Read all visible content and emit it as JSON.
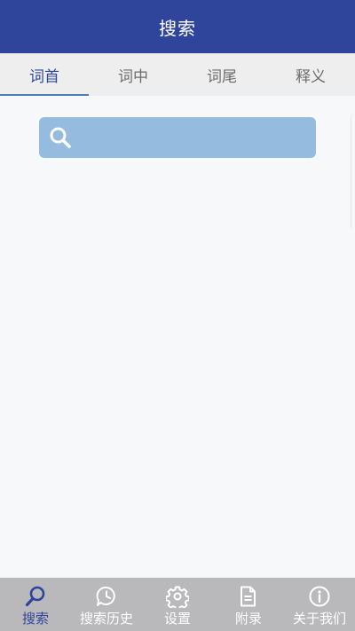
{
  "header": {
    "title": "搜索"
  },
  "tabs": [
    {
      "label": "词首",
      "active": true
    },
    {
      "label": "词中",
      "active": false
    },
    {
      "label": "词尾",
      "active": false
    },
    {
      "label": "释义",
      "active": false
    }
  ],
  "search": {
    "value": "",
    "placeholder": "",
    "icon": "search-icon"
  },
  "bottom_nav": [
    {
      "label": "搜索",
      "icon": "search-icon",
      "active": true
    },
    {
      "label": "搜索历史",
      "icon": "history-icon",
      "active": false
    },
    {
      "label": "设置",
      "icon": "gear-icon",
      "active": false
    },
    {
      "label": "附录",
      "icon": "document-icon",
      "active": false
    },
    {
      "label": "关于我们",
      "icon": "info-icon",
      "active": false
    }
  ],
  "colors": {
    "header_bg": "#2f459c",
    "accent": "#2f459c",
    "search_bg": "#95bbdf",
    "nav_bg": "#b9b9bb"
  }
}
